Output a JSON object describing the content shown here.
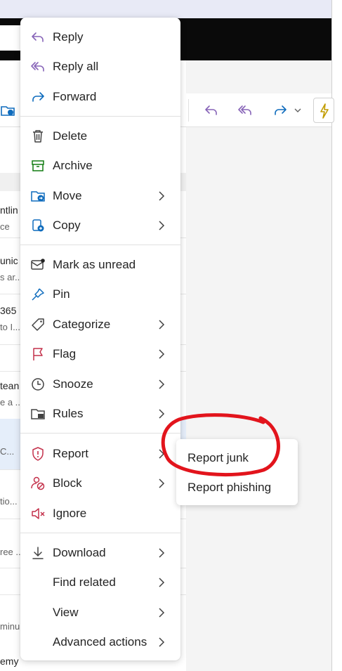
{
  "colors": {
    "accent": "#0f6cbd",
    "reply_purple": "#8764b8",
    "delete_gray": "#424242",
    "archive_green": "#107c10",
    "flag_red": "#c4314b",
    "annotation_red": "#e2141c"
  },
  "background_list": {
    "fragments": [
      "ntlin",
      "ce",
      "unic",
      "s ar...",
      "365",
      "to I...",
      "tean",
      "e a ...",
      "C...",
      "tio...",
      "ree ...",
      "minu",
      "emy"
    ]
  },
  "context_menu": {
    "groups": [
      [
        {
          "label": "Reply",
          "icon": "reply-icon",
          "submenu": false
        },
        {
          "label": "Reply all",
          "icon": "reply-all-icon",
          "submenu": false
        },
        {
          "label": "Forward",
          "icon": "forward-icon",
          "submenu": false
        }
      ],
      [
        {
          "label": "Delete",
          "icon": "trash-icon",
          "submenu": false
        },
        {
          "label": "Archive",
          "icon": "archive-icon",
          "submenu": false
        },
        {
          "label": "Move",
          "icon": "move-folder-icon",
          "submenu": true
        },
        {
          "label": "Copy",
          "icon": "copy-icon",
          "submenu": true
        }
      ],
      [
        {
          "label": "Mark as unread",
          "icon": "mail-unread-icon",
          "submenu": false
        },
        {
          "label": "Pin",
          "icon": "pin-icon",
          "submenu": false
        },
        {
          "label": "Categorize",
          "icon": "tag-icon",
          "submenu": true
        },
        {
          "label": "Flag",
          "icon": "flag-icon",
          "submenu": true
        },
        {
          "label": "Snooze",
          "icon": "clock-icon",
          "submenu": true
        },
        {
          "label": "Rules",
          "icon": "rules-icon",
          "submenu": true
        }
      ],
      [
        {
          "label": "Report",
          "icon": "shield-alert-icon",
          "submenu": true
        },
        {
          "label": "Block",
          "icon": "block-person-icon",
          "submenu": true
        },
        {
          "label": "Ignore",
          "icon": "mute-icon",
          "submenu": false
        }
      ],
      [
        {
          "label": "Download",
          "icon": "download-icon",
          "submenu": true
        },
        {
          "label": "Find related",
          "icon": "",
          "submenu": true
        },
        {
          "label": "View",
          "icon": "",
          "submenu": true
        },
        {
          "label": "Advanced actions",
          "icon": "",
          "submenu": true
        }
      ]
    ]
  },
  "report_submenu": {
    "items": [
      "Report junk",
      "Report phishing"
    ]
  }
}
